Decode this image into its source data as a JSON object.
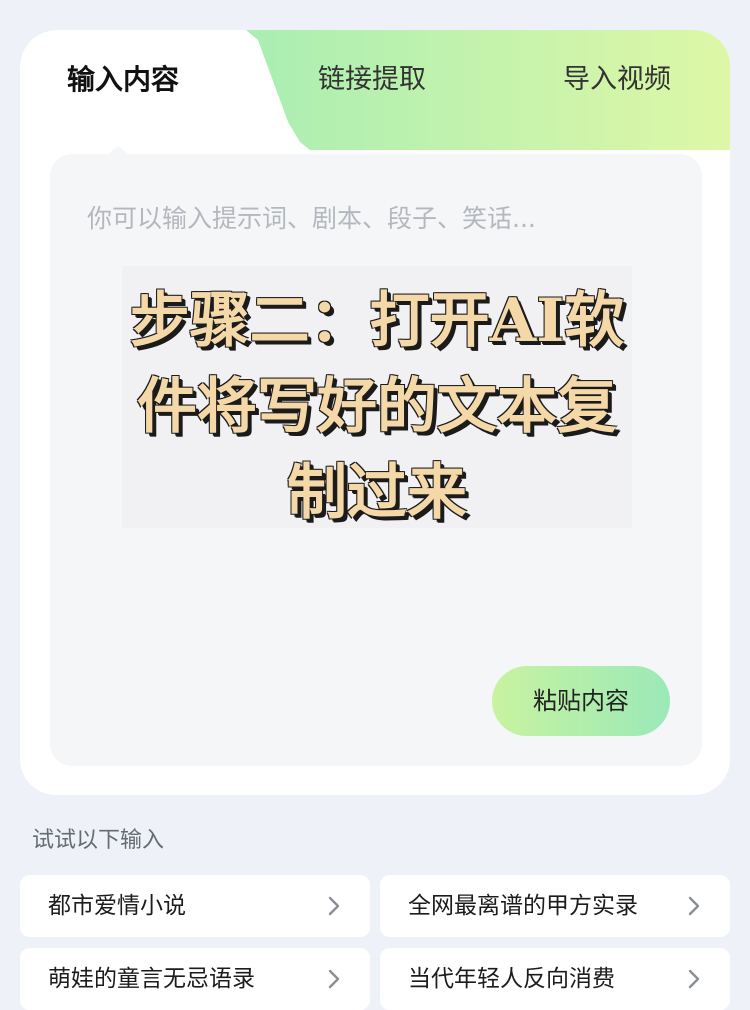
{
  "tabs": [
    {
      "label": "输入内容",
      "active": true
    },
    {
      "label": "链接提取",
      "active": false
    },
    {
      "label": "导入视频",
      "active": false
    }
  ],
  "input": {
    "placeholder": "你可以输入提示词、剧本、段子、笑话...",
    "paste_label": "粘贴内容"
  },
  "overlay": {
    "lines": [
      "步骤二：打开AI软",
      "件将写好的文本复",
      "制过来"
    ]
  },
  "suggestions": {
    "heading": "试试以下输入",
    "items": [
      {
        "label": "都市爱情小说"
      },
      {
        "label": "全网最离谱的甲方实录"
      },
      {
        "label": "萌娃的童言无忌语录"
      },
      {
        "label": "当代年轻人反向消费"
      }
    ]
  },
  "colors": {
    "accent_green": "#9be9b8",
    "accent_lime": "#def7a6",
    "overlay_text": "#f5d8a8"
  }
}
